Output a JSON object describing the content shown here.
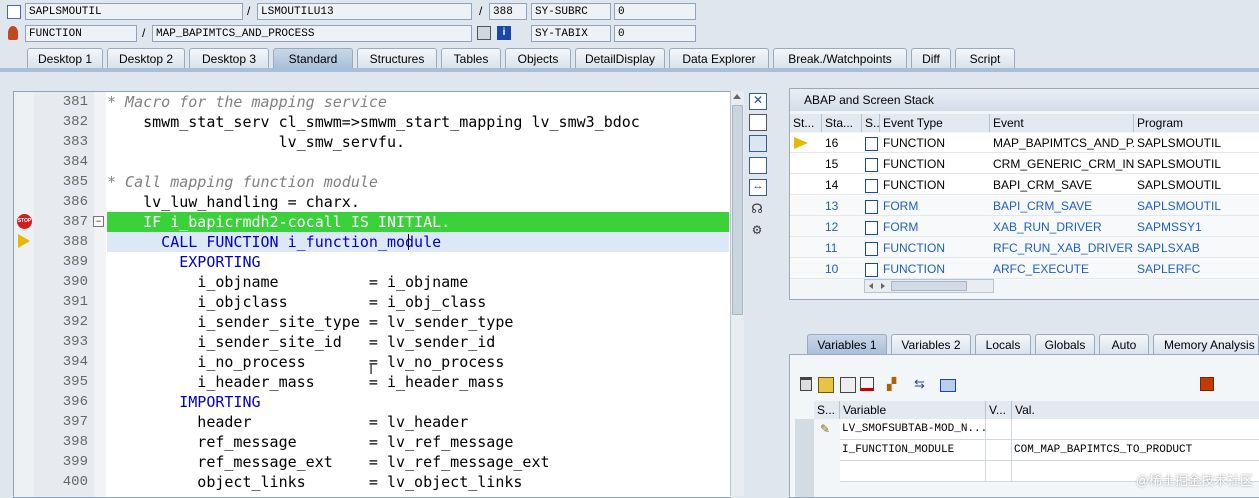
{
  "header": {
    "row1": {
      "program": "SAPLSMOUTIL",
      "include": "LSMOUTILU13",
      "line": "388",
      "field": "SY-SUBRC",
      "value": "0"
    },
    "row2": {
      "type": "FUNCTION",
      "name": "MAP_BAPIMTCS_AND_PROCESS",
      "field": "SY-TABIX",
      "value": "0"
    },
    "slash": "/"
  },
  "tabs": [
    {
      "label": "Desktop 1"
    },
    {
      "label": "Desktop 2"
    },
    {
      "label": "Desktop 3"
    },
    {
      "label": "Standard"
    },
    {
      "label": "Structures"
    },
    {
      "label": "Tables"
    },
    {
      "label": "Objects"
    },
    {
      "label": "DetailDisplay"
    },
    {
      "label": "Data Explorer"
    },
    {
      "label": "Break./Watchpoints"
    },
    {
      "label": "Diff"
    },
    {
      "label": "Script"
    }
  ],
  "editor": {
    "lines": [
      {
        "n": "381",
        "text": "* Macro for the mapping service"
      },
      {
        "n": "382",
        "text": "    smwm_stat_serv cl_smwm=>smwm_start_mapping lv_smw3_bdoc"
      },
      {
        "n": "383",
        "text": "                   lv_smw_servfu."
      },
      {
        "n": "384",
        "text": ""
      },
      {
        "n": "385",
        "text": "* Call mapping function module"
      },
      {
        "n": "386",
        "text": "    lv_luw_handling = charx."
      },
      {
        "n": "387",
        "text": "    IF i_bapicrmdh2-cocall IS INITIAL."
      },
      {
        "n": "388",
        "text": "      CALL FUNCTION i_function_module"
      },
      {
        "n": "389",
        "text": "        EXPORTING"
      },
      {
        "n": "390",
        "text": "          i_objname          = i_objname"
      },
      {
        "n": "391",
        "text": "          i_objclass         = i_obj_class"
      },
      {
        "n": "392",
        "text": "          i_sender_site_type = lv_sender_type"
      },
      {
        "n": "393",
        "text": "          i_sender_site_id   = lv_sender_id"
      },
      {
        "n": "394",
        "text": "          i_no_process       = lv_no_process"
      },
      {
        "n": "395",
        "text": "          i_header_mass      = i_header_mass"
      },
      {
        "n": "396",
        "text": "        IMPORTING"
      },
      {
        "n": "397",
        "text": "          header             = lv_header"
      },
      {
        "n": "398",
        "text": "          ref_message        = lv_ref_message"
      },
      {
        "n": "399",
        "text": "          ref_message_ext    = lv_ref_message_ext"
      },
      {
        "n": "400",
        "text": "          object_links       = lv_object_links"
      }
    ]
  },
  "stack": {
    "title": "ABAP and Screen Stack",
    "columns": [
      "St...",
      "Sta...",
      "S...",
      "Event Type",
      "Event",
      "Program"
    ],
    "rows": [
      {
        "level": "16",
        "type": "FUNCTION",
        "event": "MAP_BAPIMTCS_AND_P...",
        "program": "SAPLSMOUTIL"
      },
      {
        "level": "15",
        "type": "FUNCTION",
        "event": "CRM_GENERIC_CRM_IN",
        "program": "SAPLSMOUTIL"
      },
      {
        "level": "14",
        "type": "FUNCTION",
        "event": "BAPI_CRM_SAVE",
        "program": "SAPLSMOUTIL"
      },
      {
        "level": "13",
        "type": "FORM",
        "event": "BAPI_CRM_SAVE",
        "program": "SAPLSMOUTIL"
      },
      {
        "level": "12",
        "type": "FORM",
        "event": "XAB_RUN_DRIVER",
        "program": "SAPMSSY1"
      },
      {
        "level": "11",
        "type": "FUNCTION",
        "event": "RFC_RUN_XAB_DRIVER",
        "program": "SAPLSXAB"
      },
      {
        "level": "10",
        "type": "FUNCTION",
        "event": "ARFC_EXECUTE",
        "program": "SAPLERFC"
      }
    ]
  },
  "var_tabs": [
    {
      "label": "Variables 1"
    },
    {
      "label": "Variables 2"
    },
    {
      "label": "Locals"
    },
    {
      "label": "Globals"
    },
    {
      "label": "Auto"
    },
    {
      "label": "Memory Analysis"
    }
  ],
  "variables": {
    "columns": [
      "S...",
      "Variable",
      "V...",
      "Val."
    ],
    "rows": [
      {
        "name": "LV_SMOFSUBTAB-MOD_N...",
        "value": ""
      },
      {
        "name": "I_FUNCTION_MODULE",
        "value": "COM_MAP_BAPIMTCS_TO_PRODUCT"
      }
    ]
  },
  "watermark": "@稀土掘金技术社区",
  "colors": {
    "breakpoint_line": "#3bd13b",
    "current_line": "#dde8f7",
    "keyword": "#0000c8",
    "comment": "#808080"
  }
}
